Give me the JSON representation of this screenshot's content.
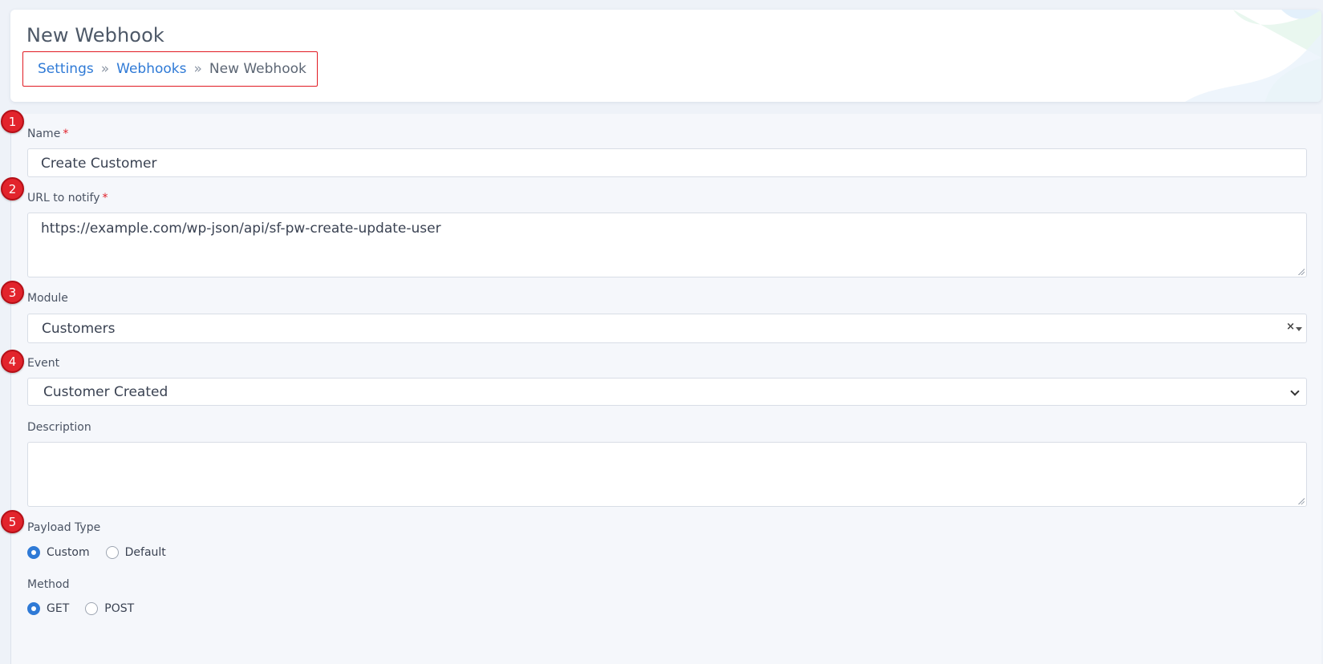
{
  "header": {
    "title": "New Webhook",
    "breadcrumb": {
      "settings": "Settings",
      "webhooks": "Webhooks",
      "current": "New Webhook",
      "separator": "»"
    }
  },
  "form": {
    "name": {
      "label": "Name",
      "required": "*",
      "value": "Create Customer"
    },
    "url": {
      "label": "URL to notify",
      "required": "*",
      "value": "https://example.com/wp-json/api/sf-pw-create-update-user"
    },
    "module": {
      "label": "Module",
      "value": "Customers",
      "clear": "×"
    },
    "event": {
      "label": "Event",
      "value": "Customer Created"
    },
    "description": {
      "label": "Description",
      "value": ""
    },
    "payload_type": {
      "label": "Payload Type",
      "options": [
        "Custom",
        "Default"
      ],
      "selected": "Custom"
    },
    "method": {
      "label": "Method",
      "options": [
        "GET",
        "POST"
      ],
      "selected": "GET"
    }
  },
  "step_badges": [
    "1",
    "2",
    "3",
    "4",
    "5"
  ],
  "colors": {
    "accent": "#2f7ad6",
    "badge": "#e2242c",
    "highlight_border": "#e11b23",
    "required": "#e0212b"
  },
  "icons": {
    "module_clear": "close-icon",
    "module_caret": "caret-down-icon",
    "event_chevron": "chevron-down-icon"
  }
}
